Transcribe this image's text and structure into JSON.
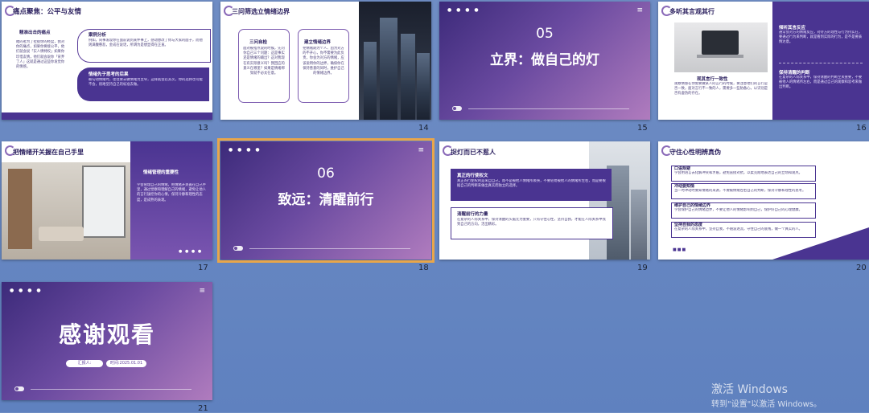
{
  "slides": {
    "s13": {
      "number": "13",
      "title": "痛点聚焦：公平与友情",
      "sub_left": "精准出击的痛点",
      "text_left": "瞎的者为了拉拢你的经度，我对你的痛点，如果你要接公平，他们就会说「实人情特权」如果你珍惜友情，他们就会说你「背弃了人」这就是通过这些你发觉你的情感。",
      "box1_title": "案例分析",
      "box1_text": "例如，同事发现你在面前说到某件事上，感动想改了你与大家的面子，而他则满腹慈悲，金成在说话，所谓为是想显得在正直。",
      "box2_title": "情绪先于思考的后果",
      "box2_text": "被勾动情绪时，往往要去做情绪为主导，这样就会忍其次，你的选择也可能不会，很难坚持自己的标准去做。"
    },
    "s14": {
      "number": "14",
      "title": "三问筛选立情绪边界",
      "b1_title": "三问自检",
      "b1_text": "面对被指点说的时候，先问你自己三个问题：这是事实还是情绪的输出？这对我现在有实际意义吗？我回应的意义在哪里？如果是情绪绑架就不必太在意。",
      "b2_title": "建立情绪边界",
      "b2_text": "把情绪期为个人、因为对方的不开心，你不需要为此负责，你会为对方的情绪，应该说明你的边界，确保你在保持善意的同时，维护自己的情绪边界。"
    },
    "s15": {
      "number": "15",
      "chapter": "05",
      "title": "立界：做自己的灯"
    },
    "s16": {
      "number": "16",
      "title": "多听其言观其行",
      "r1_title": "倾听其言反应",
      "r1_text": "通常会对方的情绪反应，对待方的理性与行为持实在，要通过行为来判断，就是看到实际的行为，是不是要表情达意。",
      "r2_title": "保持清醒的判断",
      "r2_text": "在复杂的人际关系中，保持清醒的判断至关重要，不要被他人的情绪所左右，而是通过自己的观察和思考来做出判断。",
      "c_title": "观其言行一致性",
      "c_text": "观察情感在你需要做某人的言行的时候，要注意他们的言行是否一致，面对言行不一致的人，需要多一些防备心，以识别是否有虚伪的存在。"
    },
    "s17": {
      "number": "17",
      "title": "把情绪开关握在自己手里",
      "r_title": "情绪管理的重要性",
      "r_text": "学会管理自己的情绪，把情绪开关握在自己手里，通过觉察和理解自己的情绪，避免让他人的言行操控你的心情，保持冷静和理性的态度，是成熟的表现。"
    },
    "s18": {
      "number": "18",
      "chapter": "06",
      "title": "致远：清醒前行"
    },
    "s19": {
      "number": "19",
      "title": "捉灯而已不惹人",
      "b1_title": "真正的行使权文",
      "b1_text": "真正的行使权利是来自自己，而不是被他人情绪所裹挟，不要轻易被他人的情绪所左右，而是要根据自己的判断来做出真实而独立的选择。",
      "b2_title": "清醒前行的力量",
      "b2_text": "在复杂的人际关系中，保持清醒的头脑尤为重要，只有守住心性，坚持自我，才能在人际关系中找到自己的方向，活出精彩。"
    },
    "s20": {
      "number": "20",
      "title": "守住心性明辨真伪",
      "i1_title": "口语规避",
      "i1_text": "学会用语言去化解冲突和矛盾，避免直接对抗，以柔克刚地表达自己的立场和观点。",
      "i2_title": "冲动要知情",
      "i2_text": "当一时冲动时要知情绪的来源，不要被情绪左右自己的判断，保持冷静和理性的思考。",
      "i3_title": "维护自己的情绪边界",
      "i3_text": "学会保护自己的情绪边界，不要让他人的情绪影响到自己，保护好自己的心理健康。",
      "i4_title": "坚持自我的态度",
      "i4_text": "在复杂的人际关系中，坚持自我，不随波逐流，守住自己的底线，做一个真实的人。"
    },
    "s21": {
      "number": "21",
      "title": "感谢观看",
      "reporter": "汇报人:",
      "date": "时间:2025.01.01"
    }
  },
  "watermark": {
    "line1": "激活 Windows",
    "line2": "转到\"设置\"以激活 Windows。"
  }
}
